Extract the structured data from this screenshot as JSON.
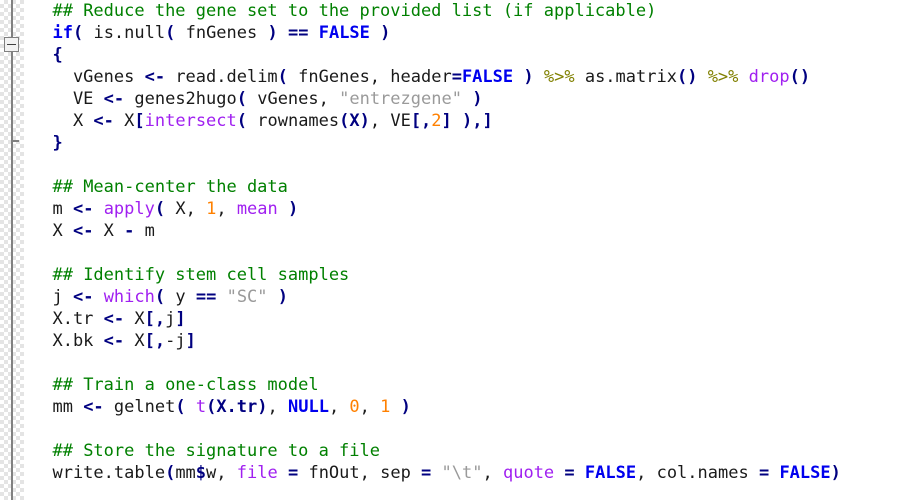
{
  "editor": {
    "language": "R",
    "background_color": "#ffffff",
    "text_color": "#1a1a1a",
    "font_size_px": 17,
    "line_height_px": 22,
    "gutter": {
      "name": "code-folding-gutter",
      "markers": [
        {
          "type": "fold-box-collapse",
          "line_index": 2,
          "symbol": "-"
        },
        {
          "type": "fold-end-bracket",
          "line_index": 6
        }
      ]
    },
    "theme_colors": {
      "comment": "#008000",
      "keyword": "#0000ee",
      "punctuation": "#000080",
      "function": "#a020f0",
      "string": "#9a9a9a",
      "number": "#ff8000",
      "operator": "#808000",
      "plain": "#1a1a1a"
    }
  },
  "lines": [
    {
      "index": 0,
      "text": "  ## Reduce the gene set to the provided list (if applicable)",
      "tokens": [
        {
          "t": "  ",
          "c": "pl"
        },
        {
          "t": "## Reduce the gene set to the provided list (if applicable)",
          "c": "cmt"
        }
      ]
    },
    {
      "index": 1,
      "text": "  if( is.null( fnGenes ) == FALSE )",
      "tokens": [
        {
          "t": "  ",
          "c": "pl"
        },
        {
          "t": "if",
          "c": "kw"
        },
        {
          "t": "(",
          "c": "punc"
        },
        {
          "t": " is.null",
          "c": "pl"
        },
        {
          "t": "(",
          "c": "punc"
        },
        {
          "t": " fnGenes ",
          "c": "pl"
        },
        {
          "t": ")",
          "c": "punc"
        },
        {
          "t": " ",
          "c": "pl"
        },
        {
          "t": "==",
          "c": "asn"
        },
        {
          "t": " ",
          "c": "pl"
        },
        {
          "t": "FALSE",
          "c": "kw"
        },
        {
          "t": " ",
          "c": "pl"
        },
        {
          "t": ")",
          "c": "punc"
        }
      ]
    },
    {
      "index": 2,
      "text": "  {",
      "tokens": [
        {
          "t": "  ",
          "c": "pl"
        },
        {
          "t": "{",
          "c": "punc"
        }
      ]
    },
    {
      "index": 3,
      "text": "    vGenes <- read.delim( fnGenes, header=FALSE ) %>% as.matrix() %>% drop()",
      "tokens": [
        {
          "t": "    vGenes ",
          "c": "pl"
        },
        {
          "t": "<-",
          "c": "asn"
        },
        {
          "t": " read.delim",
          "c": "pl"
        },
        {
          "t": "(",
          "c": "punc"
        },
        {
          "t": " fnGenes, header",
          "c": "pl"
        },
        {
          "t": "=",
          "c": "asn"
        },
        {
          "t": "FALSE",
          "c": "kw"
        },
        {
          "t": " ",
          "c": "pl"
        },
        {
          "t": ")",
          "c": "punc"
        },
        {
          "t": " ",
          "c": "pl"
        },
        {
          "t": "%>%",
          "c": "op"
        },
        {
          "t": " as.matrix",
          "c": "pl"
        },
        {
          "t": "()",
          "c": "punc"
        },
        {
          "t": " ",
          "c": "pl"
        },
        {
          "t": "%>%",
          "c": "op"
        },
        {
          "t": " ",
          "c": "pl"
        },
        {
          "t": "drop",
          "c": "fn"
        },
        {
          "t": "()",
          "c": "punc"
        }
      ]
    },
    {
      "index": 4,
      "text": "    VE <- genes2hugo( vGenes, \"entrezgene\" )",
      "tokens": [
        {
          "t": "    VE ",
          "c": "pl"
        },
        {
          "t": "<-",
          "c": "asn"
        },
        {
          "t": " genes2hugo",
          "c": "pl"
        },
        {
          "t": "(",
          "c": "punc"
        },
        {
          "t": " vGenes, ",
          "c": "pl"
        },
        {
          "t": "\"entrezgene\"",
          "c": "str"
        },
        {
          "t": " ",
          "c": "pl"
        },
        {
          "t": ")",
          "c": "punc"
        }
      ]
    },
    {
      "index": 5,
      "text": "    X <- X[intersect( rownames(X), VE[,2] ),]",
      "tokens": [
        {
          "t": "    X ",
          "c": "pl"
        },
        {
          "t": "<-",
          "c": "asn"
        },
        {
          "t": " X",
          "c": "pl"
        },
        {
          "t": "[",
          "c": "punc"
        },
        {
          "t": "intersect",
          "c": "fn"
        },
        {
          "t": "(",
          "c": "punc"
        },
        {
          "t": " rownames",
          "c": "pl"
        },
        {
          "t": "(X)",
          "c": "punc"
        },
        {
          "t": ", VE",
          "c": "pl"
        },
        {
          "t": "[,",
          "c": "punc"
        },
        {
          "t": "2",
          "c": "num"
        },
        {
          "t": "]",
          "c": "punc"
        },
        {
          "t": " ",
          "c": "pl"
        },
        {
          "t": "),]",
          "c": "punc"
        }
      ]
    },
    {
      "index": 6,
      "text": "  }",
      "tokens": [
        {
          "t": "  ",
          "c": "pl"
        },
        {
          "t": "}",
          "c": "punc"
        }
      ]
    },
    {
      "index": 7,
      "text": "",
      "tokens": []
    },
    {
      "index": 8,
      "text": "  ## Mean-center the data",
      "tokens": [
        {
          "t": "  ",
          "c": "pl"
        },
        {
          "t": "## Mean-center the data",
          "c": "cmt"
        }
      ]
    },
    {
      "index": 9,
      "text": "  m <- apply( X, 1, mean )",
      "tokens": [
        {
          "t": "  m ",
          "c": "pl"
        },
        {
          "t": "<-",
          "c": "asn"
        },
        {
          "t": " ",
          "c": "pl"
        },
        {
          "t": "apply",
          "c": "fn"
        },
        {
          "t": "(",
          "c": "punc"
        },
        {
          "t": " X, ",
          "c": "pl"
        },
        {
          "t": "1",
          "c": "num"
        },
        {
          "t": ", ",
          "c": "pl"
        },
        {
          "t": "mean",
          "c": "fn"
        },
        {
          "t": " ",
          "c": "pl"
        },
        {
          "t": ")",
          "c": "punc"
        }
      ]
    },
    {
      "index": 10,
      "text": "  X <- X - m",
      "tokens": [
        {
          "t": "  X ",
          "c": "pl"
        },
        {
          "t": "<-",
          "c": "asn"
        },
        {
          "t": " X ",
          "c": "pl"
        },
        {
          "t": "-",
          "c": "asn"
        },
        {
          "t": " m",
          "c": "pl"
        }
      ]
    },
    {
      "index": 11,
      "text": "",
      "tokens": []
    },
    {
      "index": 12,
      "text": "  ## Identify stem cell samples",
      "tokens": [
        {
          "t": "  ",
          "c": "pl"
        },
        {
          "t": "## Identify stem cell samples",
          "c": "cmt"
        }
      ]
    },
    {
      "index": 13,
      "text": "  j <- which( y == \"SC\" )",
      "tokens": [
        {
          "t": "  j ",
          "c": "pl"
        },
        {
          "t": "<-",
          "c": "asn"
        },
        {
          "t": " ",
          "c": "pl"
        },
        {
          "t": "which",
          "c": "fn"
        },
        {
          "t": "(",
          "c": "punc"
        },
        {
          "t": " y ",
          "c": "pl"
        },
        {
          "t": "==",
          "c": "asn"
        },
        {
          "t": " ",
          "c": "pl"
        },
        {
          "t": "\"SC\"",
          "c": "str"
        },
        {
          "t": " ",
          "c": "pl"
        },
        {
          "t": ")",
          "c": "punc"
        }
      ]
    },
    {
      "index": 14,
      "text": "  X.tr <- X[,j]",
      "tokens": [
        {
          "t": "  X.tr ",
          "c": "pl"
        },
        {
          "t": "<-",
          "c": "asn"
        },
        {
          "t": " X",
          "c": "pl"
        },
        {
          "t": "[,",
          "c": "punc"
        },
        {
          "t": "j",
          "c": "pl"
        },
        {
          "t": "]",
          "c": "punc"
        }
      ]
    },
    {
      "index": 15,
      "text": "  X.bk <- X[,-j]",
      "tokens": [
        {
          "t": "  X.bk ",
          "c": "pl"
        },
        {
          "t": "<-",
          "c": "asn"
        },
        {
          "t": " X",
          "c": "pl"
        },
        {
          "t": "[,",
          "c": "punc"
        },
        {
          "t": "-j",
          "c": "pl"
        },
        {
          "t": "]",
          "c": "punc"
        }
      ]
    },
    {
      "index": 16,
      "text": "",
      "tokens": []
    },
    {
      "index": 17,
      "text": "  ## Train a one-class model",
      "tokens": [
        {
          "t": "  ",
          "c": "pl"
        },
        {
          "t": "## Train a one-class model",
          "c": "cmt"
        }
      ]
    },
    {
      "index": 18,
      "text": "  mm <- gelnet( t(X.tr), NULL, 0, 1 )",
      "tokens": [
        {
          "t": "  mm ",
          "c": "pl"
        },
        {
          "t": "<-",
          "c": "asn"
        },
        {
          "t": " gelnet",
          "c": "pl"
        },
        {
          "t": "(",
          "c": "punc"
        },
        {
          "t": " ",
          "c": "pl"
        },
        {
          "t": "t",
          "c": "fn"
        },
        {
          "t": "(X.tr)",
          "c": "punc"
        },
        {
          "t": ", ",
          "c": "pl"
        },
        {
          "t": "NULL",
          "c": "kw"
        },
        {
          "t": ", ",
          "c": "pl"
        },
        {
          "t": "0",
          "c": "num"
        },
        {
          "t": ", ",
          "c": "pl"
        },
        {
          "t": "1",
          "c": "num"
        },
        {
          "t": " ",
          "c": "pl"
        },
        {
          "t": ")",
          "c": "punc"
        }
      ]
    },
    {
      "index": 19,
      "text": "",
      "tokens": []
    },
    {
      "index": 20,
      "text": "  ## Store the signature to a file",
      "tokens": [
        {
          "t": "  ",
          "c": "pl"
        },
        {
          "t": "## Store the signature to a file",
          "c": "cmt"
        }
      ]
    },
    {
      "index": 21,
      "text": "  write.table(mm$w, file = fnOut, sep = \"\\t\", quote = FALSE, col.names = FALSE)",
      "tokens": [
        {
          "t": "  write.table",
          "c": "pl"
        },
        {
          "t": "(",
          "c": "punc"
        },
        {
          "t": "mm",
          "c": "pl"
        },
        {
          "t": "$",
          "c": "punc"
        },
        {
          "t": "w, ",
          "c": "pl"
        },
        {
          "t": "file",
          "c": "fn"
        },
        {
          "t": " ",
          "c": "pl"
        },
        {
          "t": "=",
          "c": "asn"
        },
        {
          "t": " fnOut, sep ",
          "c": "pl"
        },
        {
          "t": "=",
          "c": "asn"
        },
        {
          "t": " ",
          "c": "pl"
        },
        {
          "t": "\"\\t\"",
          "c": "str"
        },
        {
          "t": ", ",
          "c": "pl"
        },
        {
          "t": "quote",
          "c": "fn"
        },
        {
          "t": " ",
          "c": "pl"
        },
        {
          "t": "=",
          "c": "asn"
        },
        {
          "t": " ",
          "c": "pl"
        },
        {
          "t": "FALSE",
          "c": "kw"
        },
        {
          "t": ", col.names ",
          "c": "pl"
        },
        {
          "t": "=",
          "c": "asn"
        },
        {
          "t": " ",
          "c": "pl"
        },
        {
          "t": "FALSE",
          "c": "kw"
        },
        {
          "t": ")",
          "c": "punc"
        }
      ]
    }
  ]
}
